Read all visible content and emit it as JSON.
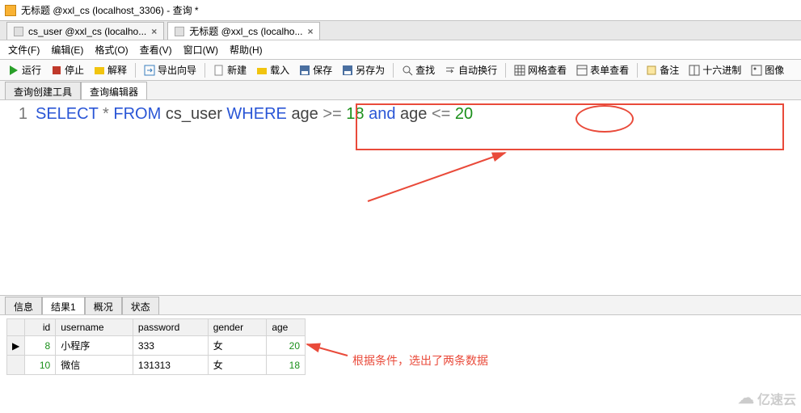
{
  "window": {
    "title": "无标题 @xxl_cs (localhost_3306) - 查询 *"
  },
  "file_tabs": {
    "t0": {
      "label": "cs_user @xxl_cs (localho..."
    },
    "t1": {
      "label": "无标题 @xxl_cs (localho..."
    }
  },
  "menu": {
    "file": "文件(F)",
    "edit": "编辑(E)",
    "format": "格式(O)",
    "view": "查看(V)",
    "window": "窗口(W)",
    "help": "帮助(H)"
  },
  "toolbar": {
    "run": "运行",
    "stop": "停止",
    "explain": "解释",
    "export": "导出向导",
    "new": "新建",
    "load": "载入",
    "save": "保存",
    "saveas": "另存为",
    "find": "查找",
    "wrap": "自动换行",
    "gridview": "网格查看",
    "formview": "表单查看",
    "note": "备注",
    "hex": "十六进制",
    "image": "图像"
  },
  "subtabs": {
    "builder": "查询创建工具",
    "editor": "查询编辑器"
  },
  "sql": {
    "lineno": "1",
    "select": "SELECT",
    "star": "*",
    "from": "FROM",
    "table": "cs_user",
    "where": "WHERE",
    "col1": "age",
    "gte": ">=",
    "v1": "18",
    "and": "and",
    "col2": "age",
    "lte": "<=",
    "v2": "20"
  },
  "result_tabs": {
    "info": "信息",
    "res1": "结果1",
    "profile": "概况",
    "status": "状态"
  },
  "grid": {
    "headers": {
      "id": "id",
      "username": "username",
      "password": "password",
      "gender": "gender",
      "age": "age"
    },
    "rows": [
      {
        "ptr": "▶",
        "id": "8",
        "username": "小程序",
        "password": "333",
        "gender": "女",
        "age": "20"
      },
      {
        "ptr": "",
        "id": "10",
        "username": "微信",
        "password": "131313",
        "gender": "女",
        "age": "18"
      }
    ]
  },
  "annot": {
    "text": "根据条件，选出了两条数据"
  },
  "watermark": {
    "text": "亿速云"
  }
}
